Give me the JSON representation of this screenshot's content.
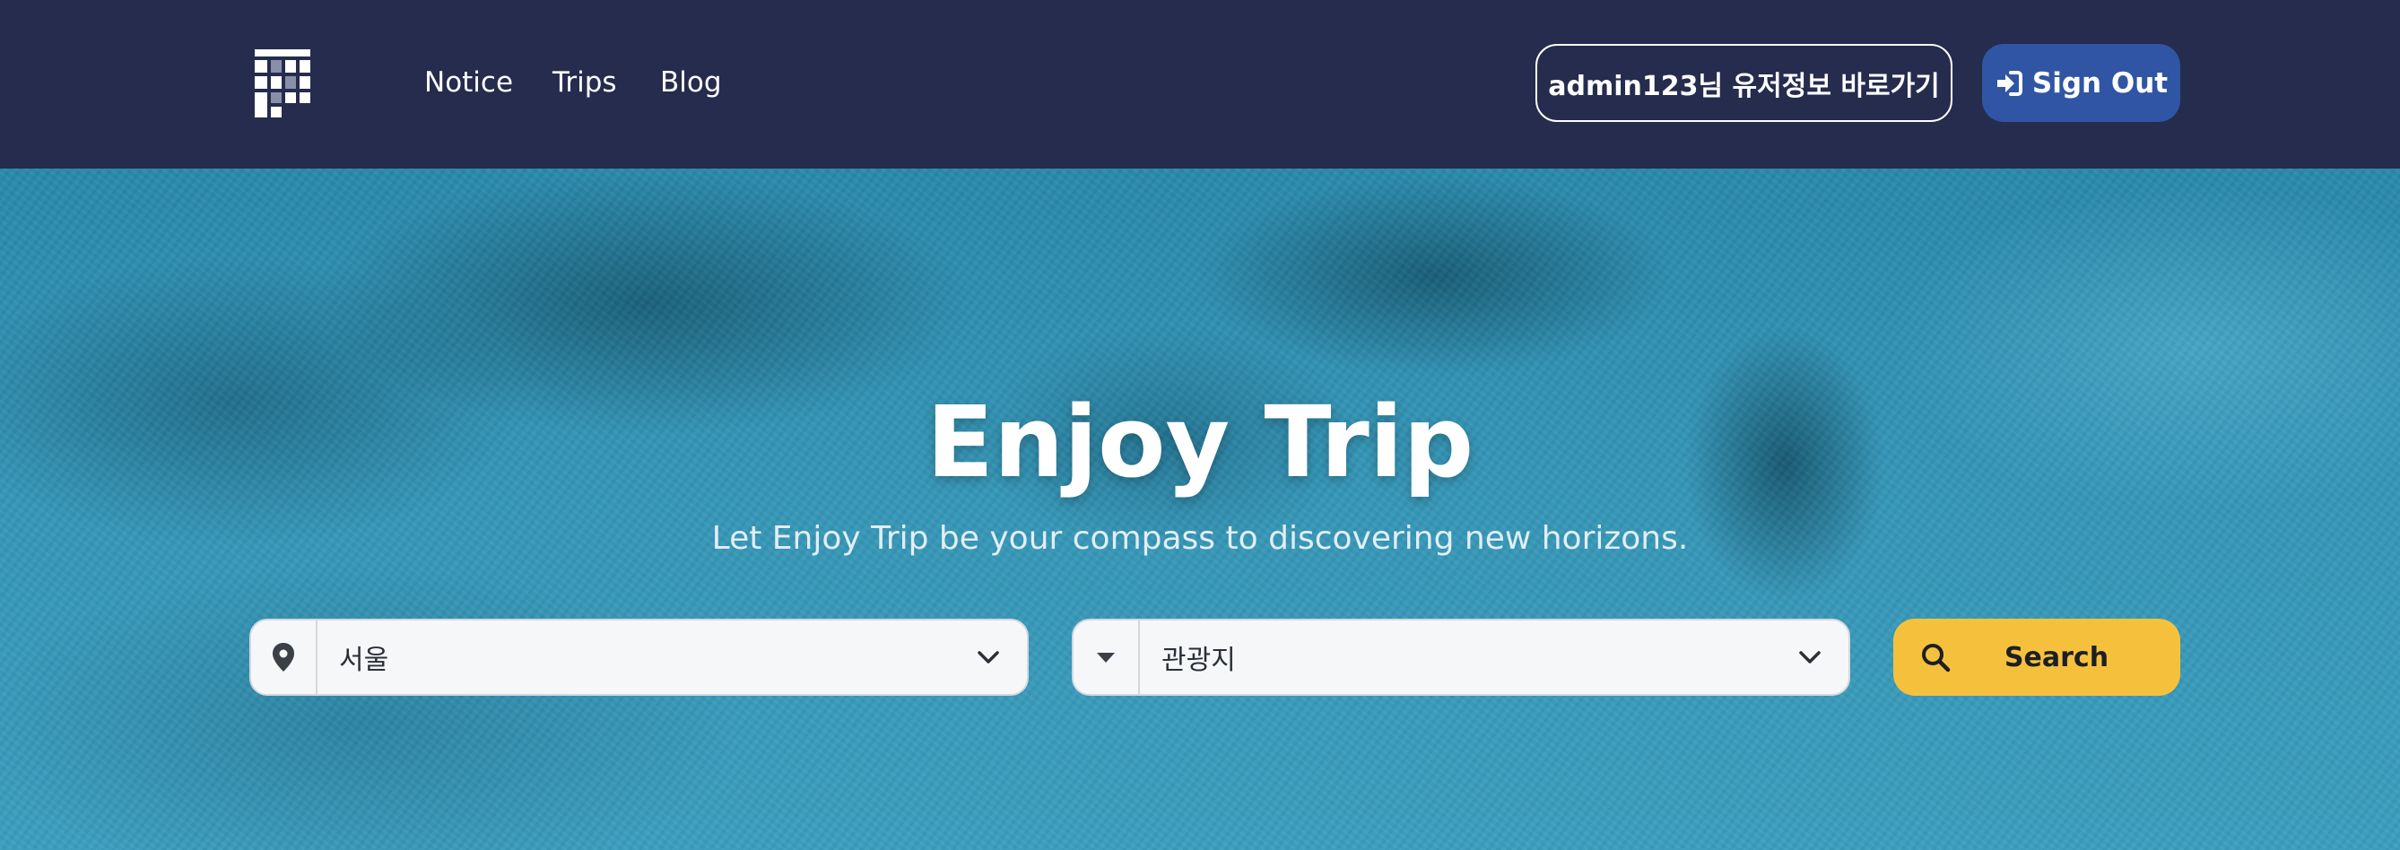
{
  "navbar": {
    "links": [
      {
        "label": "Notice"
      },
      {
        "label": "Trips"
      },
      {
        "label": "Blog"
      }
    ],
    "profile_button": "admin123님 유저정보 바로가기",
    "signout_button": "Sign Out"
  },
  "hero": {
    "title": "Enjoy Trip",
    "subtitle": "Let Enjoy Trip be your compass to discovering new horizons."
  },
  "search": {
    "region_select": {
      "icon": "map-pin-icon",
      "value": "서울"
    },
    "type_select": {
      "icon": "caret-down-icon",
      "value": "관광지"
    },
    "button_label": "Search"
  },
  "colors": {
    "navbar_bg": "#252c4d",
    "signout_bg": "#2f55a4",
    "search_bg": "#f5c13d",
    "hero_water": "#3597b8"
  }
}
